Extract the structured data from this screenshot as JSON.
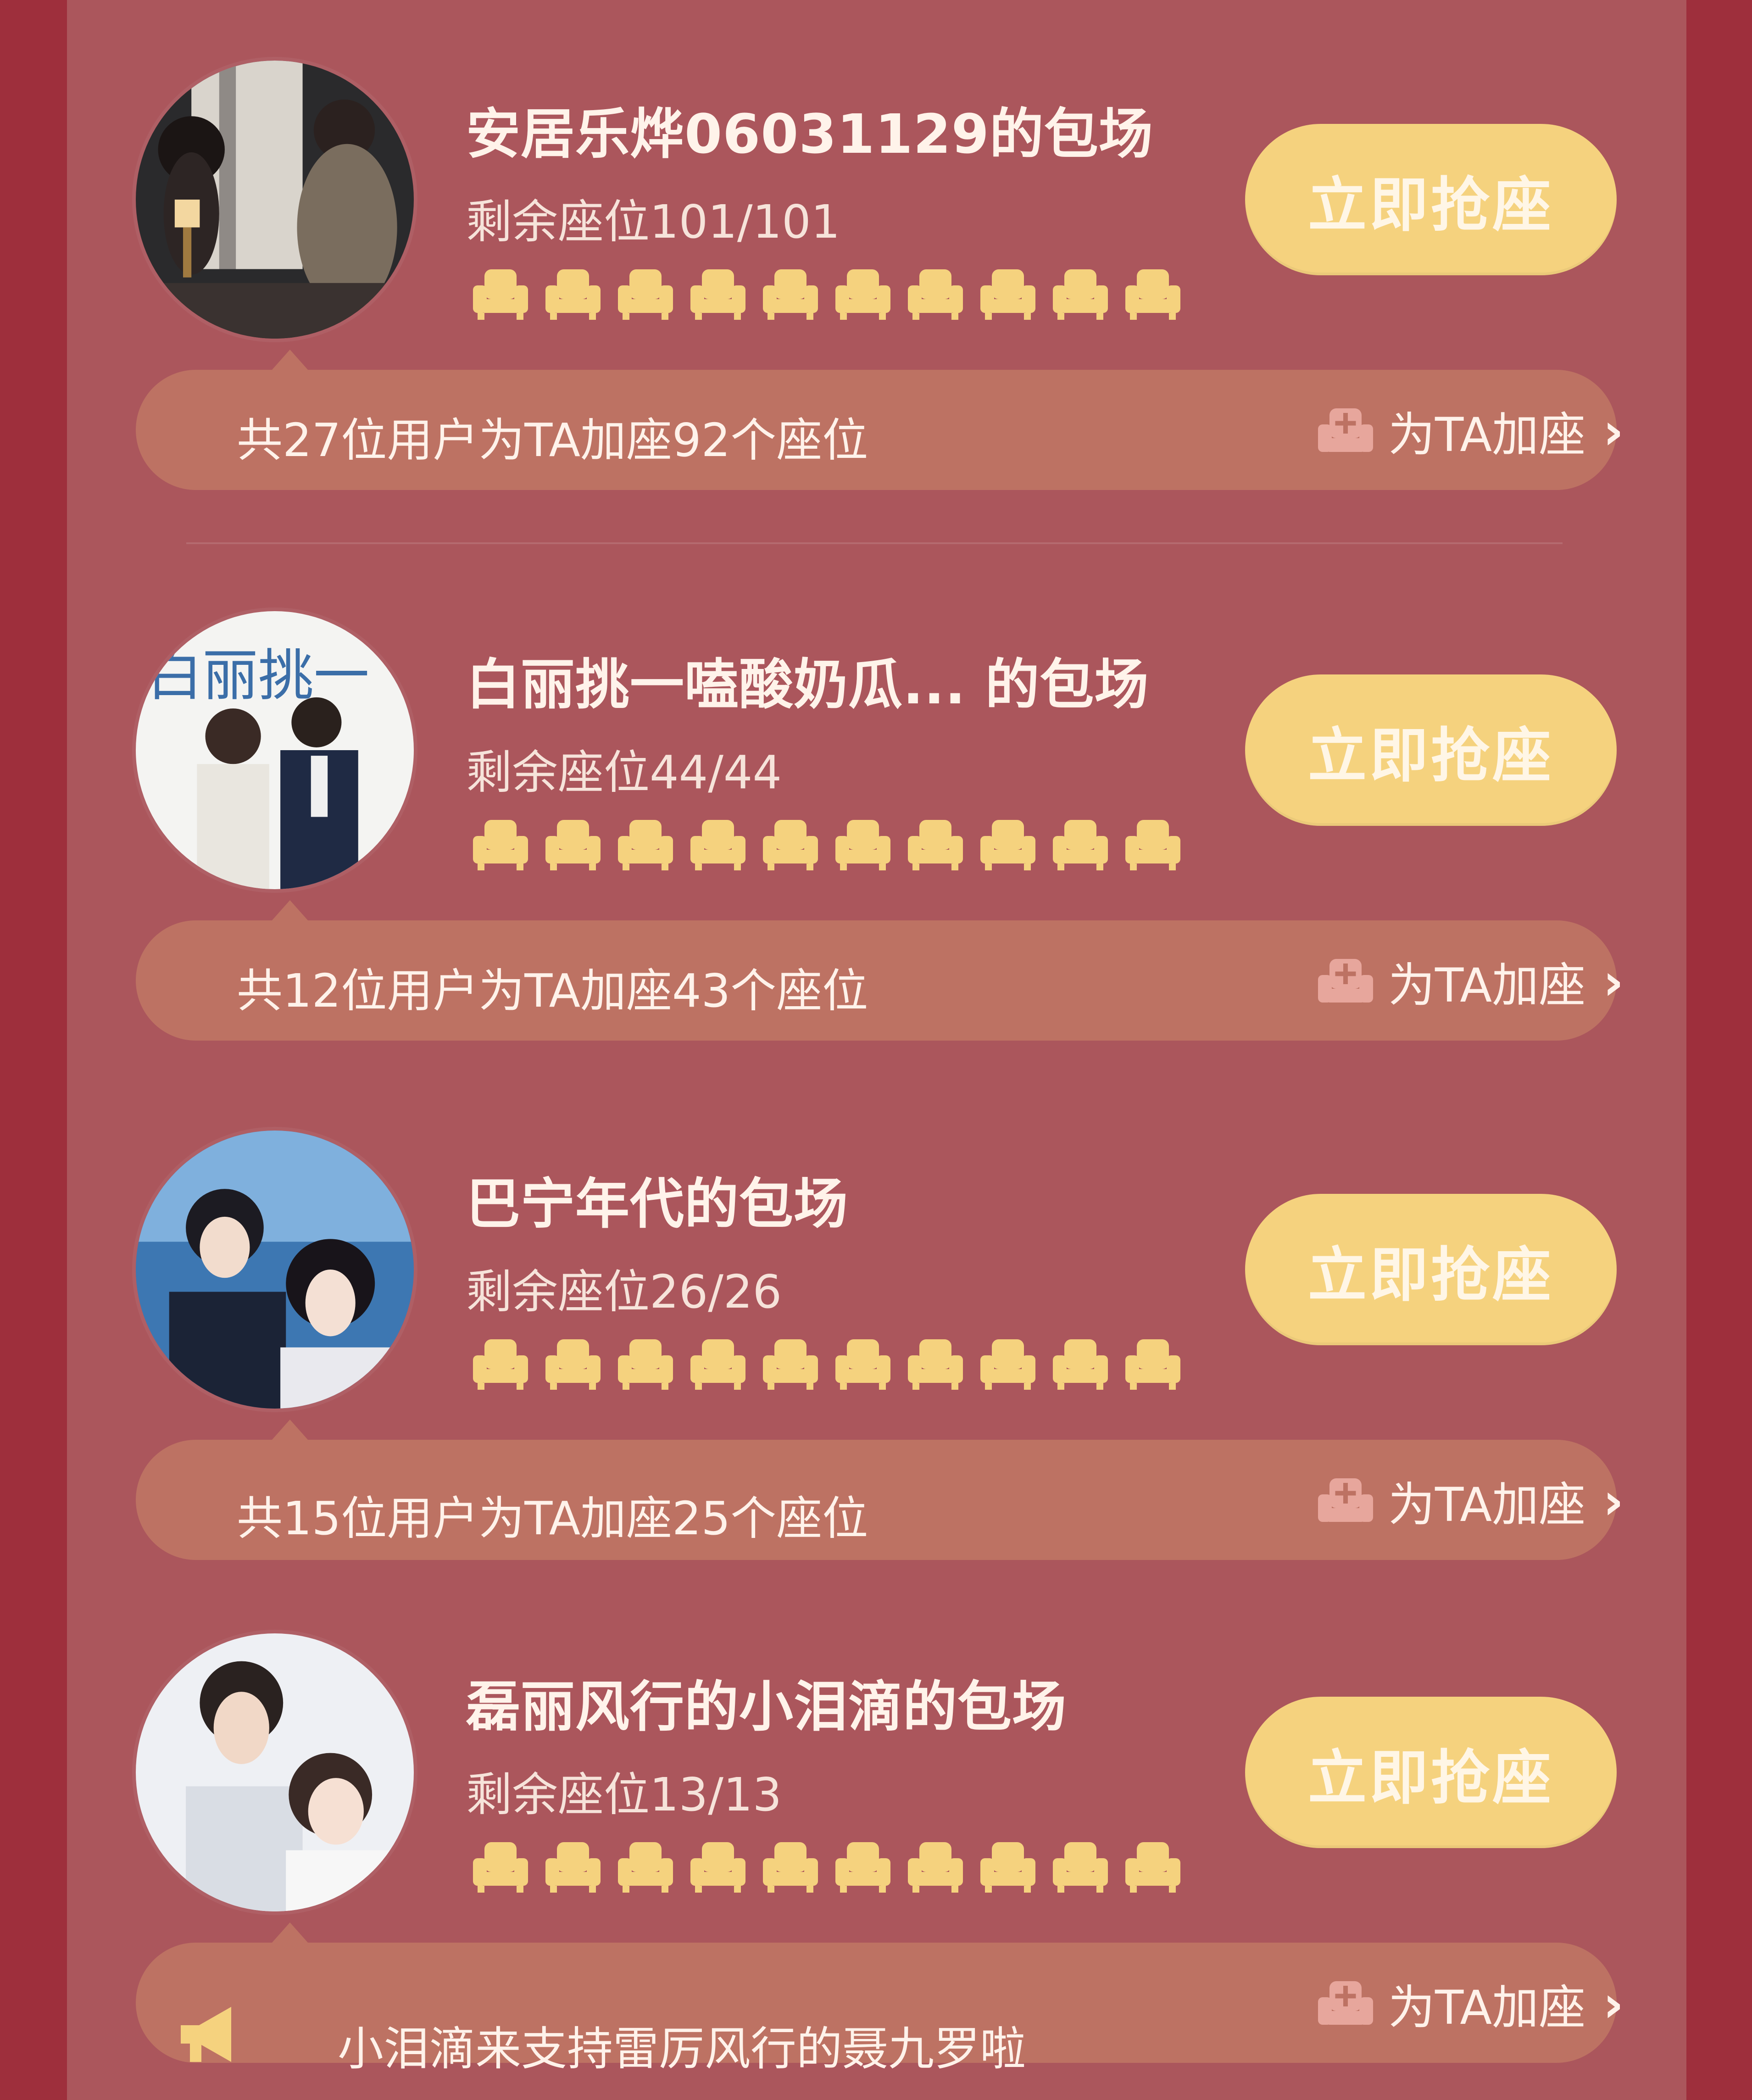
{
  "colors": {
    "outer_bg": "#9e2f3c",
    "panel_bg": "#ab565c",
    "info_bar_bg": "#bd7263",
    "button_bg": "#f5d27e",
    "seat_icon": "#f5d27e"
  },
  "cards": [
    {
      "title": "安居乐烨06031129的包场",
      "seats_text": "剩余座位101/101",
      "button_label": "立即抢座",
      "info_text": "共27位用户为TA加座92个座位",
      "add_seat_label": "为TA加座",
      "chevron": "›"
    },
    {
      "title": "白丽挑一嗑酸奶瓜...  的包场",
      "seats_text": "剩余座位44/44",
      "button_label": "立即抢座",
      "info_text": "共12位用户为TA加座43个座位",
      "add_seat_label": "为TA加座",
      "chevron": "›",
      "avatar_text": "白丽挑一"
    },
    {
      "title": "巴宁年代的包场",
      "seats_text": "剩余座位26/26",
      "button_label": "立即抢座",
      "info_text": "共15位用户为TA加座25个座位",
      "add_seat_label": "为TA加座",
      "chevron": "›"
    },
    {
      "title": "磊丽风行的小泪滴的包场",
      "seats_text": "剩余座位13/13",
      "button_label": "立即抢座",
      "info_text": "小泪滴来支持雷厉风行的聂九罗啦",
      "add_seat_label": "为TA加座",
      "chevron": "›"
    }
  ],
  "icons": {
    "seat": "sofa-seat-icon",
    "add_seat": "add-seat-icon",
    "megaphone": "megaphone-icon"
  }
}
